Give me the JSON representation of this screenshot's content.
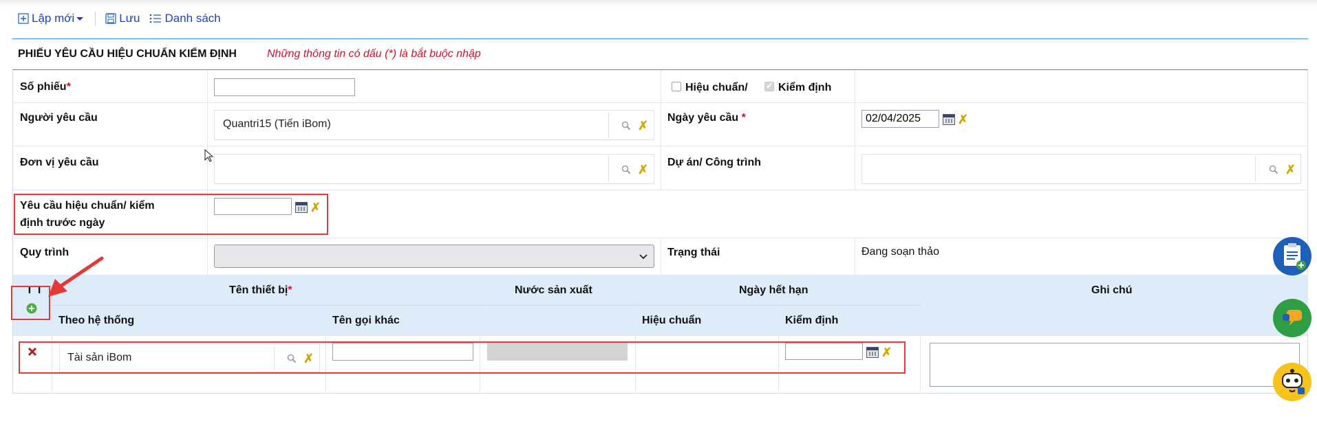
{
  "toolbar": {
    "new_label": "Lập mới",
    "save_label": "Lưu",
    "list_label": "Danh sách"
  },
  "form": {
    "title": "PHIẾU YÊU CẦU HIỆU CHUẨN KIỂM ĐỊNH",
    "required_note": "Những thông tin có dấu (*) là bắt buộc nhập"
  },
  "fields": {
    "so_phieu_label": "Số phiếu",
    "so_phieu_value": "",
    "hieu_chuan_label": "Hiệu chuẩn/",
    "hieu_chuan_checked": false,
    "kiem_dinh_label": "Kiểm định",
    "kiem_dinh_checked": true,
    "nguoi_yeu_cau_label": "Người yêu cầu",
    "nguoi_yeu_cau_value": "Quantri15 (Tiến iBom)",
    "ngay_yeu_cau_label": "Ngày yêu cầu ",
    "ngay_yeu_cau_value": "02/04/2025",
    "don_vi_label": "Đơn vị yêu cầu",
    "don_vi_value": "",
    "du_an_label": "Dự án/ Công trình",
    "du_an_value": "",
    "truoc_ngay_label_1": "Yêu cầu hiệu chuẩn/ kiểm",
    "truoc_ngay_label_2": "định trước ngày",
    "truoc_ngay_value": "",
    "quy_trinh_label": "Quy trình",
    "quy_trinh_value": "",
    "trang_thai_label": "Trạng thái",
    "trang_thai_value": "Đang soạn thảo",
    "required_mark": "*"
  },
  "table": {
    "col_tt": "T T",
    "col_ten_thiet_bi": "Tên thiết bị",
    "col_nuoc_san_xuat": "Nước sản xuất",
    "col_ngay_het_han": "Ngày hết hạn",
    "col_ghi_chu": "Ghi chú",
    "sub_theo_he_thong": "Theo hệ thống",
    "sub_ten_goi_khac": "Tên gọi khác",
    "sub_hieu_chuan": "Hiệu chuẩn",
    "sub_kiem_dinh": "Kiểm định",
    "rows": [
      {
        "theo_he_thong": "Tài sản iBom",
        "ten_goi_khac": "",
        "nuoc_san_xuat": "",
        "hieu_chuan": "",
        "kiem_dinh": "",
        "ghi_chu": ""
      }
    ]
  },
  "colors": {
    "accent": "#1a3fd0",
    "required": "#d0112b",
    "header_bg": "#deebf8",
    "highlight": "#e53935"
  }
}
